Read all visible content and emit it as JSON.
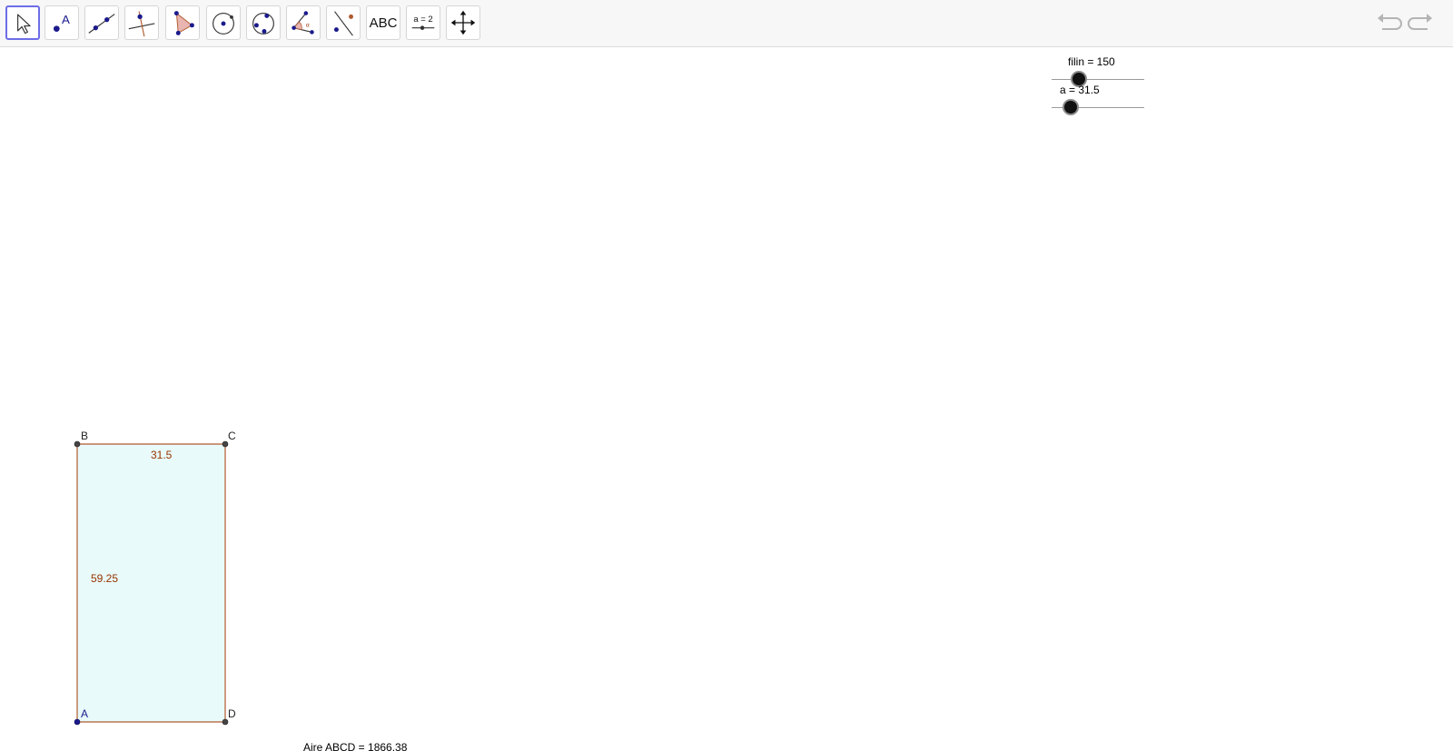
{
  "toolbar": {
    "tools": [
      {
        "name": "move-tool",
        "icon": "arrow-pointer-icon"
      },
      {
        "name": "point-tool",
        "icon": "point-a-icon",
        "label": "A"
      },
      {
        "name": "line-tool",
        "icon": "line-through-points-icon"
      },
      {
        "name": "perpendicular-line-tool",
        "icon": "perpendicular-line-icon"
      },
      {
        "name": "polygon-tool",
        "icon": "polygon-icon"
      },
      {
        "name": "circle-center-point-tool",
        "icon": "circle-center-icon"
      },
      {
        "name": "circle-three-points-tool",
        "icon": "circle-three-points-icon"
      },
      {
        "name": "angle-tool",
        "icon": "angle-icon",
        "label": "α"
      },
      {
        "name": "reflect-tool",
        "icon": "reflect-line-icon"
      },
      {
        "name": "text-tool",
        "icon": "text-icon",
        "label": "ABC"
      },
      {
        "name": "slider-tool",
        "icon": "slider-icon",
        "label": "a = 2"
      },
      {
        "name": "move-graphics-view-tool",
        "icon": "move-arrows-icon"
      }
    ],
    "undo_icon": "undo-icon",
    "redo_icon": "redo-icon"
  },
  "sliders": [
    {
      "label": "filin = 150",
      "value": 150,
      "position_fraction": 0.29
    },
    {
      "label": "a = 31.5",
      "value": 31.5,
      "position_fraction": 0.2
    }
  ],
  "figure": {
    "points": {
      "A": "A",
      "B": "B",
      "C": "C",
      "D": "D"
    },
    "side_top_label": "31.5",
    "side_left_label": "59.25",
    "area_text": "Aire ABCD = 1866.38"
  },
  "colors": {
    "selection_border": "#6d6de8",
    "polygon_fill": "#e8fafa",
    "polygon_stroke": "#b05a2e",
    "segment_label": "#993300",
    "point_free": "#1a1a8c",
    "point_dependent": "#333333"
  }
}
